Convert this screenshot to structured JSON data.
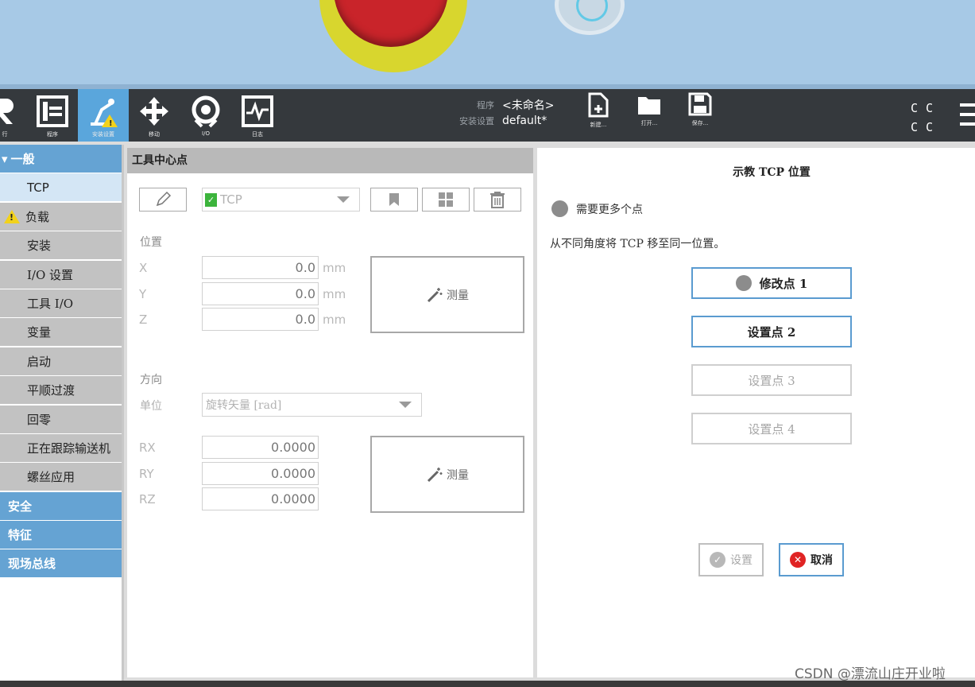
{
  "toolbar": {
    "buttons": [
      {
        "label": "行",
        "icon": "run-icon"
      },
      {
        "label": "程序",
        "icon": "program-icon"
      },
      {
        "label": "安装设置",
        "icon": "installation-icon",
        "active": true
      },
      {
        "label": "移动",
        "icon": "move-icon"
      },
      {
        "label": "I/O",
        "icon": "io-icon"
      },
      {
        "label": "日志",
        "icon": "log-icon"
      }
    ],
    "program_key": "程序",
    "program_value": "<未命名>",
    "install_key": "安装设置",
    "install_value": "default*",
    "new_label": "新建...",
    "open_label": "打开...",
    "save_label": "保存...",
    "mode_glyphs": [
      "C",
      "C",
      "C",
      "C"
    ]
  },
  "sidebar": {
    "items": [
      {
        "label": "一般",
        "kind": "head"
      },
      {
        "label": "TCP",
        "kind": "sub",
        "selected": true
      },
      {
        "label": "负载",
        "kind": "sub",
        "warning": true
      },
      {
        "label": "安装",
        "kind": "sub"
      },
      {
        "label": "I/O 设置",
        "kind": "sub"
      },
      {
        "label": "工具 I/O",
        "kind": "sub"
      },
      {
        "label": "变量",
        "kind": "sub"
      },
      {
        "label": "启动",
        "kind": "sub"
      },
      {
        "label": "平顺过渡",
        "kind": "sub"
      },
      {
        "label": "回零",
        "kind": "sub"
      },
      {
        "label": "正在跟踪输送机",
        "kind": "sub"
      },
      {
        "label": "螺丝应用",
        "kind": "sub"
      },
      {
        "label": "安全",
        "kind": "head"
      },
      {
        "label": "特征",
        "kind": "head"
      },
      {
        "label": "现场总线",
        "kind": "head"
      }
    ]
  },
  "tcp_panel": {
    "title": "工具中心点",
    "tcp_select": "TCP",
    "position_label": "位置",
    "position": [
      {
        "axis": "X",
        "value": "0.0",
        "unit": "mm"
      },
      {
        "axis": "Y",
        "value": "0.0",
        "unit": "mm"
      },
      {
        "axis": "Z",
        "value": "0.0",
        "unit": "mm"
      }
    ],
    "measure_label": "测量",
    "orientation_label": "方向",
    "unit_label": "单位",
    "unit_select": "旋转矢量 [rad]",
    "orientation": [
      {
        "axis": "RX",
        "value": "0.0000"
      },
      {
        "axis": "RY",
        "value": "0.0000"
      },
      {
        "axis": "RZ",
        "value": "0.0000"
      }
    ]
  },
  "teach_panel": {
    "title": "示教 TCP 位置",
    "status": "需要更多个点",
    "instruction": "从不同角度将 TCP 移至同一位置。",
    "points": [
      {
        "label": "修改点 1",
        "state": "on",
        "dot": true
      },
      {
        "label": "设置点 2",
        "state": "on",
        "dot": false
      },
      {
        "label": "设置点 3",
        "state": "off",
        "dot": false
      },
      {
        "label": "设置点 4",
        "state": "off",
        "dot": false
      }
    ],
    "ok_label": "设置",
    "cancel_label": "取消",
    "colors": {
      "accent": "#5a9bd0",
      "cancel": "#e02424",
      "header": "#65a3d3"
    }
  },
  "watermark": "CSDN @漂流山庄开业啦"
}
